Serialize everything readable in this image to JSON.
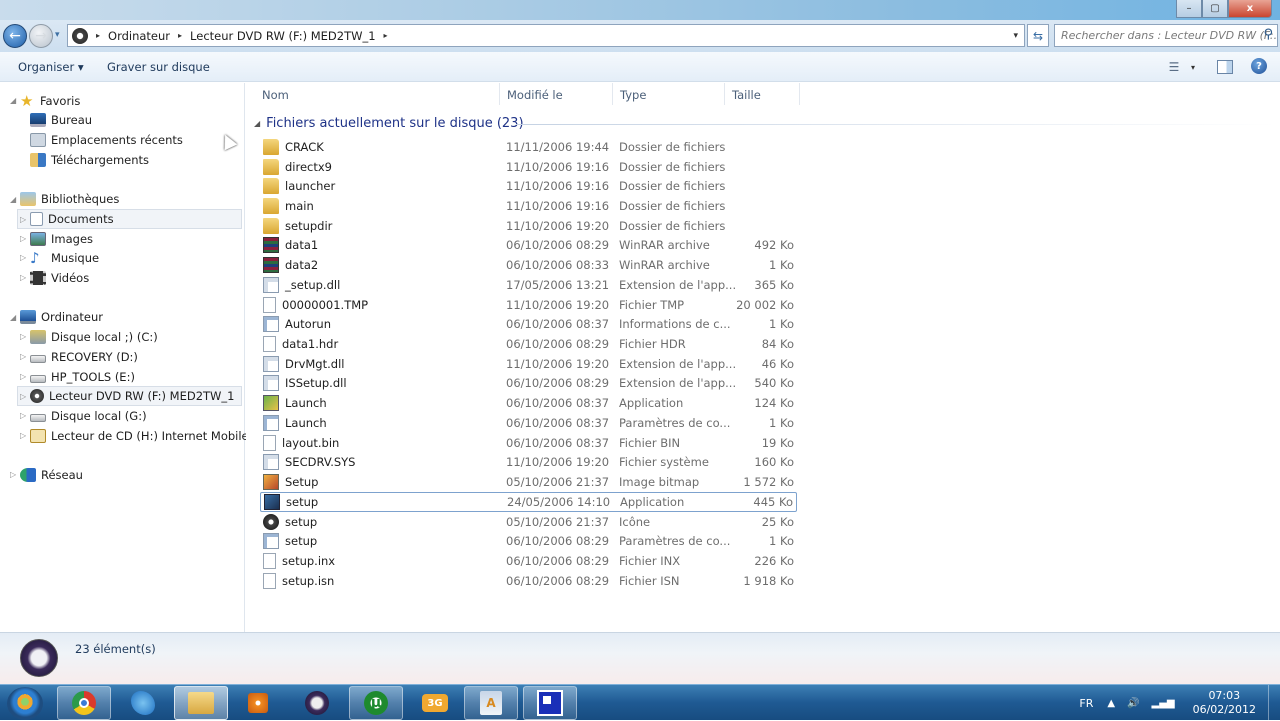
{
  "window": {
    "controls": {
      "minimize": "–",
      "maximize": "▢",
      "close": "x"
    }
  },
  "navigation": {
    "back_icon": "←",
    "forward_icon": "→",
    "recent_dropdown": "▾",
    "breadcrumb": [
      "Ordinateur",
      "Lecteur DVD RW (F:) MED2TW_1"
    ],
    "breadcrumb_sep": "▸",
    "address_dropdown": "▾",
    "refresh_icon": "⇆",
    "search_placeholder": "Rechercher dans : Lecteur DVD RW (F:...",
    "search_icon": "⚲"
  },
  "toolbar": {
    "organize_label": "Organiser ▾",
    "burn_label": "Graver sur disque",
    "views_icon": "☰",
    "views_dropdown": "▾",
    "help_icon": "?"
  },
  "sidebar": {
    "favorites": {
      "label": "Favoris",
      "items": [
        "Bureau",
        "Emplacements récents",
        "Téléchargements"
      ]
    },
    "libraries": {
      "label": "Bibliothèques",
      "items": [
        "Documents",
        "Images",
        "Musique",
        "Vidéos"
      ],
      "selected": "Documents"
    },
    "computer": {
      "label": "Ordinateur",
      "items": [
        "Disque local ;) (C:)",
        "RECOVERY (D:)",
        "HP_TOOLS (E:)",
        "Lecteur DVD RW (F:) MED2TW_1",
        "Disque local (G:)",
        "Lecteur de CD (H:) Internet Mobile"
      ],
      "selected": "Lecteur DVD RW (F:) MED2TW_1"
    },
    "network": {
      "label": "Réseau"
    },
    "expand_open": "◢",
    "expand_closed": "▷"
  },
  "main": {
    "columns": [
      "Nom",
      "Modifié le",
      "Type",
      "Taille"
    ],
    "group_label": "Fichiers actuellement sur le disque (23)",
    "group_toggle": "◢",
    "selected_index": 18,
    "files": [
      {
        "name": "CRACK",
        "date": "11/11/2006 19:44",
        "type": "Dossier de fichiers",
        "size": "",
        "icon": "folder"
      },
      {
        "name": "directx9",
        "date": "11/10/2006 19:16",
        "type": "Dossier de fichiers",
        "size": "",
        "icon": "folder"
      },
      {
        "name": "launcher",
        "date": "11/10/2006 19:16",
        "type": "Dossier de fichiers",
        "size": "",
        "icon": "folder"
      },
      {
        "name": "main",
        "date": "11/10/2006 19:16",
        "type": "Dossier de fichiers",
        "size": "",
        "icon": "folder"
      },
      {
        "name": "setupdir",
        "date": "11/10/2006 19:20",
        "type": "Dossier de fichiers",
        "size": "",
        "icon": "folder"
      },
      {
        "name": "data1",
        "date": "06/10/2006 08:29",
        "type": "WinRAR archive",
        "size": "492 Ko",
        "icon": "rar"
      },
      {
        "name": "data2",
        "date": "06/10/2006 08:33",
        "type": "WinRAR archive",
        "size": "1 Ko",
        "icon": "rar"
      },
      {
        "name": "_setup.dll",
        "date": "17/05/2006 13:21",
        "type": "Extension de l'app...",
        "size": "365 Ko",
        "icon": "dll"
      },
      {
        "name": "00000001.TMP",
        "date": "11/10/2006 19:20",
        "type": "Fichier TMP",
        "size": "20 002 Ko",
        "icon": "blank"
      },
      {
        "name": "Autorun",
        "date": "06/10/2006 08:37",
        "type": "Informations de c...",
        "size": "1 Ko",
        "icon": "ini"
      },
      {
        "name": "data1.hdr",
        "date": "06/10/2006 08:29",
        "type": "Fichier HDR",
        "size": "84 Ko",
        "icon": "blank"
      },
      {
        "name": "DrvMgt.dll",
        "date": "11/10/2006 19:20",
        "type": "Extension de l'app...",
        "size": "46 Ko",
        "icon": "dll"
      },
      {
        "name": "ISSetup.dll",
        "date": "06/10/2006 08:29",
        "type": "Extension de l'app...",
        "size": "540 Ko",
        "icon": "dll"
      },
      {
        "name": "Launch",
        "date": "06/10/2006 08:37",
        "type": "Application",
        "size": "124 Ko",
        "icon": "app"
      },
      {
        "name": "Launch",
        "date": "06/10/2006 08:37",
        "type": "Paramètres de co...",
        "size": "1 Ko",
        "icon": "ini"
      },
      {
        "name": "layout.bin",
        "date": "06/10/2006 08:37",
        "type": "Fichier BIN",
        "size": "19 Ko",
        "icon": "blank"
      },
      {
        "name": "SECDRV.SYS",
        "date": "11/10/2006 19:20",
        "type": "Fichier système",
        "size": "160 Ko",
        "icon": "dll"
      },
      {
        "name": "Setup",
        "date": "05/10/2006 21:37",
        "type": "Image bitmap",
        "size": "1 572 Ko",
        "icon": "bmp"
      },
      {
        "name": "setup",
        "date": "24/05/2006 14:10",
        "type": "Application",
        "size": "445 Ko",
        "icon": "setup"
      },
      {
        "name": "setup",
        "date": "05/10/2006 21:37",
        "type": "Icône",
        "size": "25 Ko",
        "icon": "ico"
      },
      {
        "name": "setup",
        "date": "06/10/2006 08:29",
        "type": "Paramètres de co...",
        "size": "1 Ko",
        "icon": "ini"
      },
      {
        "name": "setup.inx",
        "date": "06/10/2006 08:29",
        "type": "Fichier INX",
        "size": "226 Ko",
        "icon": "blank"
      },
      {
        "name": "setup.isn",
        "date": "06/10/2006 08:29",
        "type": "Fichier ISN",
        "size": "1 918 Ko",
        "icon": "blank"
      }
    ]
  },
  "status": {
    "text": "23 élément(s)"
  },
  "taskbar": {
    "apps": [
      {
        "name": "chrome",
        "state": "open"
      },
      {
        "name": "internet-explorer",
        "state": ""
      },
      {
        "name": "windows-explorer",
        "state": "active"
      },
      {
        "name": "media-player",
        "state": ""
      },
      {
        "name": "screen-capture",
        "state": ""
      },
      {
        "name": "utorrent",
        "state": "open",
        "glyph": "µ"
      },
      {
        "name": "3g-connect",
        "state": "",
        "glyph": "3G"
      },
      {
        "name": "font-viewer",
        "state": "open",
        "glyph": "A"
      },
      {
        "name": "blue-app",
        "state": "open"
      }
    ],
    "tray": {
      "language": "FR",
      "show_hidden": "▲",
      "volume": "🔊",
      "signal": "▂▄▆",
      "time": "07:03",
      "date": "06/02/2012"
    }
  }
}
